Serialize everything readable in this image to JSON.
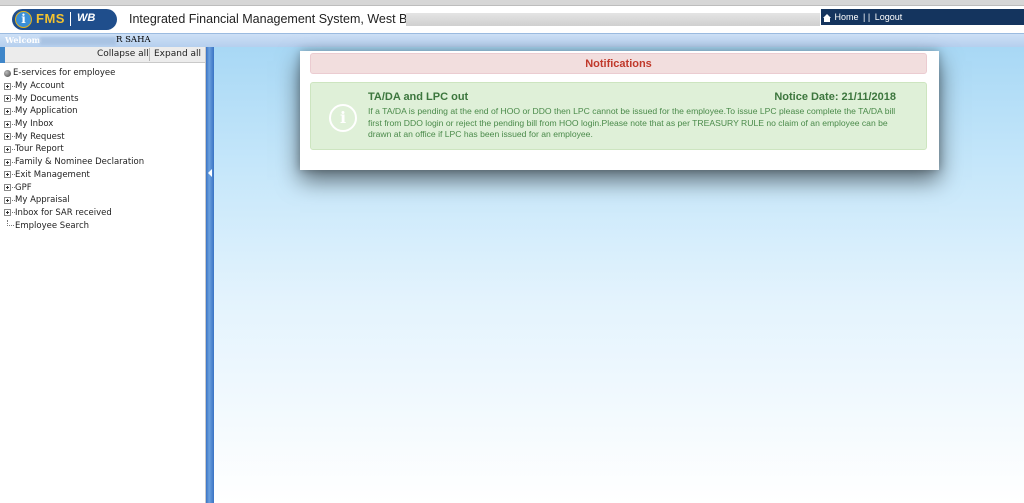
{
  "header": {
    "logo": {
      "icon_letter": "i",
      "fms": "FMS",
      "wb": "WB"
    },
    "app_title": "Integrated Financial Management System, West Bengal",
    "nav": {
      "home_icon": "home-icon",
      "home": "Home",
      "separator": "| |",
      "logout": "Logout"
    }
  },
  "welcome": {
    "label": "Welcome :",
    "name_suffix": "R SAHA"
  },
  "sidebar": {
    "collapse_all": "Collapse all",
    "expand_all": "Expand all",
    "root": "E-services for employee",
    "items": [
      {
        "label": "My Account",
        "expandable": true
      },
      {
        "label": "My Documents",
        "expandable": true
      },
      {
        "label": "My Application",
        "expandable": true
      },
      {
        "label": "My Inbox",
        "expandable": true
      },
      {
        "label": "My Request",
        "expandable": true
      },
      {
        "label": "Tour Report",
        "expandable": true
      },
      {
        "label": "Family & Nominee Declaration",
        "expandable": true
      },
      {
        "label": "Exit Management",
        "expandable": true
      },
      {
        "label": "GPF",
        "expandable": true
      },
      {
        "label": "My Appraisal",
        "expandable": true
      },
      {
        "label": "Inbox for SAR received",
        "expandable": true
      },
      {
        "label": "Employee Search",
        "expandable": false
      }
    ]
  },
  "notification": {
    "header": "Notifications",
    "icon": "info-icon",
    "title": "TA/DA and LPC out",
    "date": "Notice Date: 21/11/2018",
    "body": "If a TA/DA is pending at the end of HOO or DDO then LPC cannot be issued for the employee.To issue LPC please complete the TA/DA bill first from DDO login or reject the pending bill from HOO login.Please note that as per TREASURY RULE no claim of an employee can be drawn at an office if LPC has been issued for an employee."
  },
  "colors": {
    "brand_blue": "#1f4e8c",
    "nav_bar": "#14345e",
    "notif_header_bg": "#f2dede",
    "notif_header_text": "#c0392b",
    "notice_bg": "#dff0d8",
    "notice_text": "#3c763d"
  }
}
